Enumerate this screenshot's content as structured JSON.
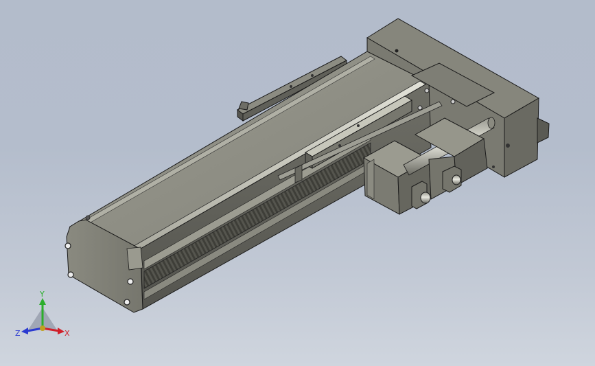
{
  "viewport": {
    "background_top": "#b3bccb",
    "background_bottom": "#cfd5de"
  },
  "model": {
    "part_color": "#7c7c72",
    "face_light": "#a8a89c",
    "face_mid": "#8e8e84",
    "face_dark": "#5c5c55",
    "edge_color": "#1a1a1a",
    "rail_color": "#c8c8bc"
  },
  "triad": {
    "x_label": "X",
    "y_label": "Y",
    "z_label": "Z",
    "x_color": "#d0202a",
    "y_color": "#2cae2c",
    "z_color": "#2a3ad0"
  }
}
